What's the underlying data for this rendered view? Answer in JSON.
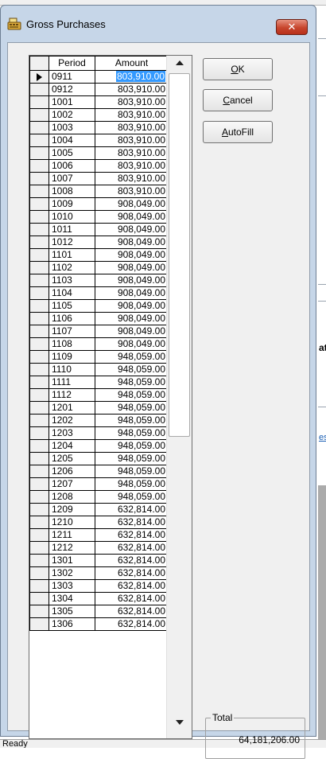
{
  "window": {
    "title": "Gross Purchases",
    "close_label": "✕"
  },
  "grid": {
    "columns": [
      "Period",
      "Amount"
    ],
    "selected_row": 0,
    "rows": [
      {
        "period": "0911",
        "amount": "803,910.00"
      },
      {
        "period": "0912",
        "amount": "803,910.00"
      },
      {
        "period": "1001",
        "amount": "803,910.00"
      },
      {
        "period": "1002",
        "amount": "803,910.00"
      },
      {
        "period": "1003",
        "amount": "803,910.00"
      },
      {
        "period": "1004",
        "amount": "803,910.00"
      },
      {
        "period": "1005",
        "amount": "803,910.00"
      },
      {
        "period": "1006",
        "amount": "803,910.00"
      },
      {
        "period": "1007",
        "amount": "803,910.00"
      },
      {
        "period": "1008",
        "amount": "803,910.00"
      },
      {
        "period": "1009",
        "amount": "908,049.00"
      },
      {
        "period": "1010",
        "amount": "908,049.00"
      },
      {
        "period": "1011",
        "amount": "908,049.00"
      },
      {
        "period": "1012",
        "amount": "908,049.00"
      },
      {
        "period": "1101",
        "amount": "908,049.00"
      },
      {
        "period": "1102",
        "amount": "908,049.00"
      },
      {
        "period": "1103",
        "amount": "908,049.00"
      },
      {
        "period": "1104",
        "amount": "908,049.00"
      },
      {
        "period": "1105",
        "amount": "908,049.00"
      },
      {
        "period": "1106",
        "amount": "908,049.00"
      },
      {
        "period": "1107",
        "amount": "908,049.00"
      },
      {
        "period": "1108",
        "amount": "908,049.00"
      },
      {
        "period": "1109",
        "amount": "948,059.00"
      },
      {
        "period": "1110",
        "amount": "948,059.00"
      },
      {
        "period": "1111",
        "amount": "948,059.00"
      },
      {
        "period": "1112",
        "amount": "948,059.00"
      },
      {
        "period": "1201",
        "amount": "948,059.00"
      },
      {
        "period": "1202",
        "amount": "948,059.00"
      },
      {
        "period": "1203",
        "amount": "948,059.00"
      },
      {
        "period": "1204",
        "amount": "948,059.00"
      },
      {
        "period": "1205",
        "amount": "948,059.00"
      },
      {
        "period": "1206",
        "amount": "948,059.00"
      },
      {
        "period": "1207",
        "amount": "948,059.00"
      },
      {
        "period": "1208",
        "amount": "948,059.00"
      },
      {
        "period": "1209",
        "amount": "632,814.00"
      },
      {
        "period": "1210",
        "amount": "632,814.00"
      },
      {
        "period": "1211",
        "amount": "632,814.00"
      },
      {
        "period": "1212",
        "amount": "632,814.00"
      },
      {
        "period": "1301",
        "amount": "632,814.00"
      },
      {
        "period": "1302",
        "amount": "632,814.00"
      },
      {
        "period": "1303",
        "amount": "632,814.00"
      },
      {
        "period": "1304",
        "amount": "632,814.00"
      },
      {
        "period": "1305",
        "amount": "632,814.00"
      },
      {
        "period": "1306",
        "amount": "632,814.00"
      }
    ]
  },
  "buttons": {
    "ok": {
      "mnemonic": "O",
      "rest": "K"
    },
    "cancel": {
      "mnemonic": "C",
      "rest": "ancel"
    },
    "autofill": {
      "mnemonic": "A",
      "rest": "utoFill"
    }
  },
  "total": {
    "label": "Total",
    "value": "64,181,206.00"
  },
  "background": {
    "bold_fragment": "ati",
    "link_fragment": "esp"
  },
  "status": {
    "text": "Ready"
  },
  "colors": {
    "selection": "#3399ff",
    "close_button": "#c7452d",
    "dialog_frame": "#c6d6e8"
  },
  "icons": {
    "title": "cash-register-icon",
    "close": "close-icon",
    "row_indicator": "current-row-arrow-icon",
    "scroll_up": "scroll-up-arrow-icon",
    "scroll_down": "scroll-down-arrow-icon"
  }
}
